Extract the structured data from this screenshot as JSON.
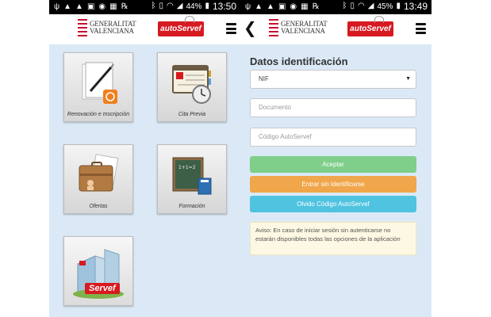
{
  "left": {
    "status": {
      "time": "13:50",
      "battery": "44%"
    },
    "header": {
      "gv_line1": "GENERALITAT",
      "gv_line2": "VALENCIANA",
      "app_logo": "autoServef"
    },
    "tiles": [
      {
        "label": "Renovación e Inscripción",
        "icon": "document-pen-icon"
      },
      {
        "label": "Cita Previa",
        "icon": "agenda-clock-icon"
      },
      {
        "label": "Ofertas",
        "icon": "briefcase-icon"
      },
      {
        "label": "Formación",
        "icon": "chalkboard-icon"
      },
      {
        "label": "",
        "icon": "servef-building-icon",
        "logo_text": "Servef"
      }
    ]
  },
  "right": {
    "status": {
      "time": "13:49",
      "battery": "45%"
    },
    "header": {
      "gv_line1": "GENERALITAT",
      "gv_line2": "VALENCIANA",
      "app_logo": "autoServef"
    },
    "form": {
      "title": "Datos identificación",
      "doc_type": {
        "value": "NIF"
      },
      "documento": {
        "placeholder": "Documento"
      },
      "codigo": {
        "placeholder": "Código AutoServef"
      },
      "accept_label": "Aceptar",
      "enter_label": "Entrar sin identificarse",
      "forgot_label": "Olvido Código AutoServef",
      "notice": "Aviso: En caso de iniciar sesión sin autenticarse no estarán disponibles todas las opciones de la aplicación"
    },
    "colors": {
      "accept": "#7fcf8a",
      "enter": "#f0a64a",
      "forgot": "#4fc3e0"
    }
  }
}
